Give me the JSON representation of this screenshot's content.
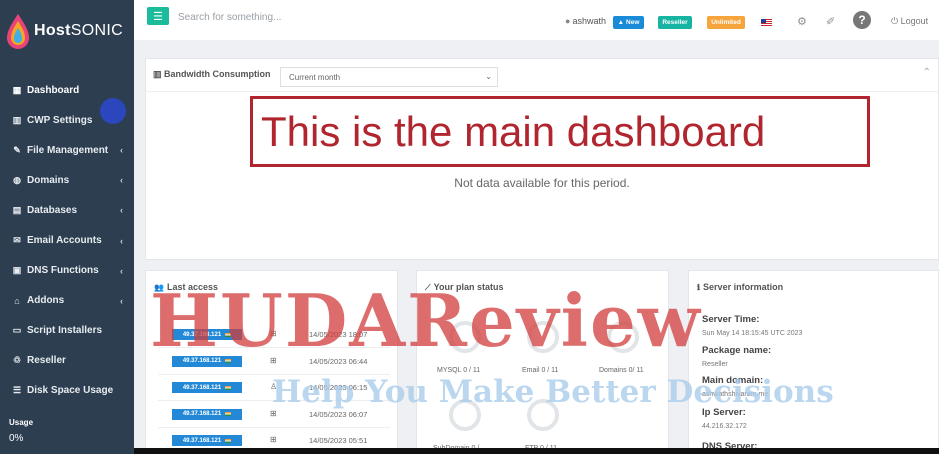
{
  "brand": {
    "bold": "Host",
    "thin": "SONIC"
  },
  "sidebar": {
    "items": [
      {
        "label": "Dashboard",
        "icon": "dashboard-icon",
        "glyph": "▦",
        "chevron": ""
      },
      {
        "label": "CWP Settings",
        "icon": "bar-chart-icon",
        "glyph": "▥",
        "chevron": ""
      },
      {
        "label": "File Management",
        "icon": "edit-icon",
        "glyph": "✎",
        "chevron": "‹"
      },
      {
        "label": "Domains",
        "icon": "globe-icon",
        "glyph": "◍",
        "chevron": "‹"
      },
      {
        "label": "Databases",
        "icon": "database-icon",
        "glyph": "▤",
        "chevron": "‹"
      },
      {
        "label": "Email Accounts",
        "icon": "envelope-icon",
        "glyph": "✉",
        "chevron": "‹"
      },
      {
        "label": "DNS Functions",
        "icon": "server-icon",
        "glyph": "▣",
        "chevron": "‹"
      },
      {
        "label": "Addons",
        "icon": "building-icon",
        "glyph": "⌂",
        "chevron": "‹"
      },
      {
        "label": "Script Installers",
        "icon": "monitor-icon",
        "glyph": "▭",
        "chevron": ""
      },
      {
        "label": "Reseller",
        "icon": "recycle-icon",
        "glyph": "♲",
        "chevron": ""
      },
      {
        "label": "Disk Space Usage",
        "icon": "list-icon",
        "glyph": "☰",
        "chevron": ""
      }
    ],
    "usage_label": "Usage",
    "usage_value": "0%"
  },
  "topbar": {
    "search_placeholder": "Search for something...",
    "username": "ashwath",
    "badge_new": "New",
    "badge_reseller": "Reseller",
    "badge_unlimited": "Unlimited",
    "logout": "Logout",
    "help": "?"
  },
  "bandwidth": {
    "title": "Bandwidth Consumption",
    "select_value": "Current month",
    "annotation": "This is the main dashboard",
    "no_data": "Not data available for this period."
  },
  "last_access": {
    "title": "Last access",
    "rows": [
      {
        "ip": "49.37.168.121",
        "os": "windows",
        "os_glyph": "⊞",
        "time": "14/05/2023 18:07"
      },
      {
        "ip": "49.37.168.121",
        "os": "windows",
        "os_glyph": "⊞",
        "time": "14/05/2023 06:44"
      },
      {
        "ip": "49.37.168.121",
        "os": "linux",
        "os_glyph": "♙",
        "time": "14/05/2023 06:15"
      },
      {
        "ip": "49.37.168.121",
        "os": "windows",
        "os_glyph": "⊞",
        "time": "14/05/2023 06:07"
      },
      {
        "ip": "49.37.168.121",
        "os": "windows",
        "os_glyph": "⊞",
        "time": "14/05/2023 05:51"
      }
    ]
  },
  "plan_status": {
    "title": "Your plan status",
    "mysql": "MYSQL 0 / 11",
    "email": "Email 0 / 11",
    "domains": "Domains 0/ 11",
    "subdomain": "SubDomain 0 /",
    "ftp": "FTP 0 / 11"
  },
  "server_info": {
    "title": "Server information",
    "server_time_label": "Server Time:",
    "server_time": "Sun May 14 18:15:45 UTC 2023",
    "package_label": "Package name:",
    "package": "Reseller",
    "main_domain_label": "Main domain:",
    "main_domain": "ashwathshivaram.me",
    "ip_label": "Ip Server:",
    "ip": "44.216.32.172",
    "dns_label": "DNS Server:"
  },
  "watermark": {
    "line1": "HUDAReview",
    "line2": "Help You Make Better Decisions"
  },
  "colors": {
    "sidebar": "#2c3e50",
    "accent": "#1abc9c",
    "annotation": "#b0252e",
    "ip_chip": "#2389d6"
  }
}
